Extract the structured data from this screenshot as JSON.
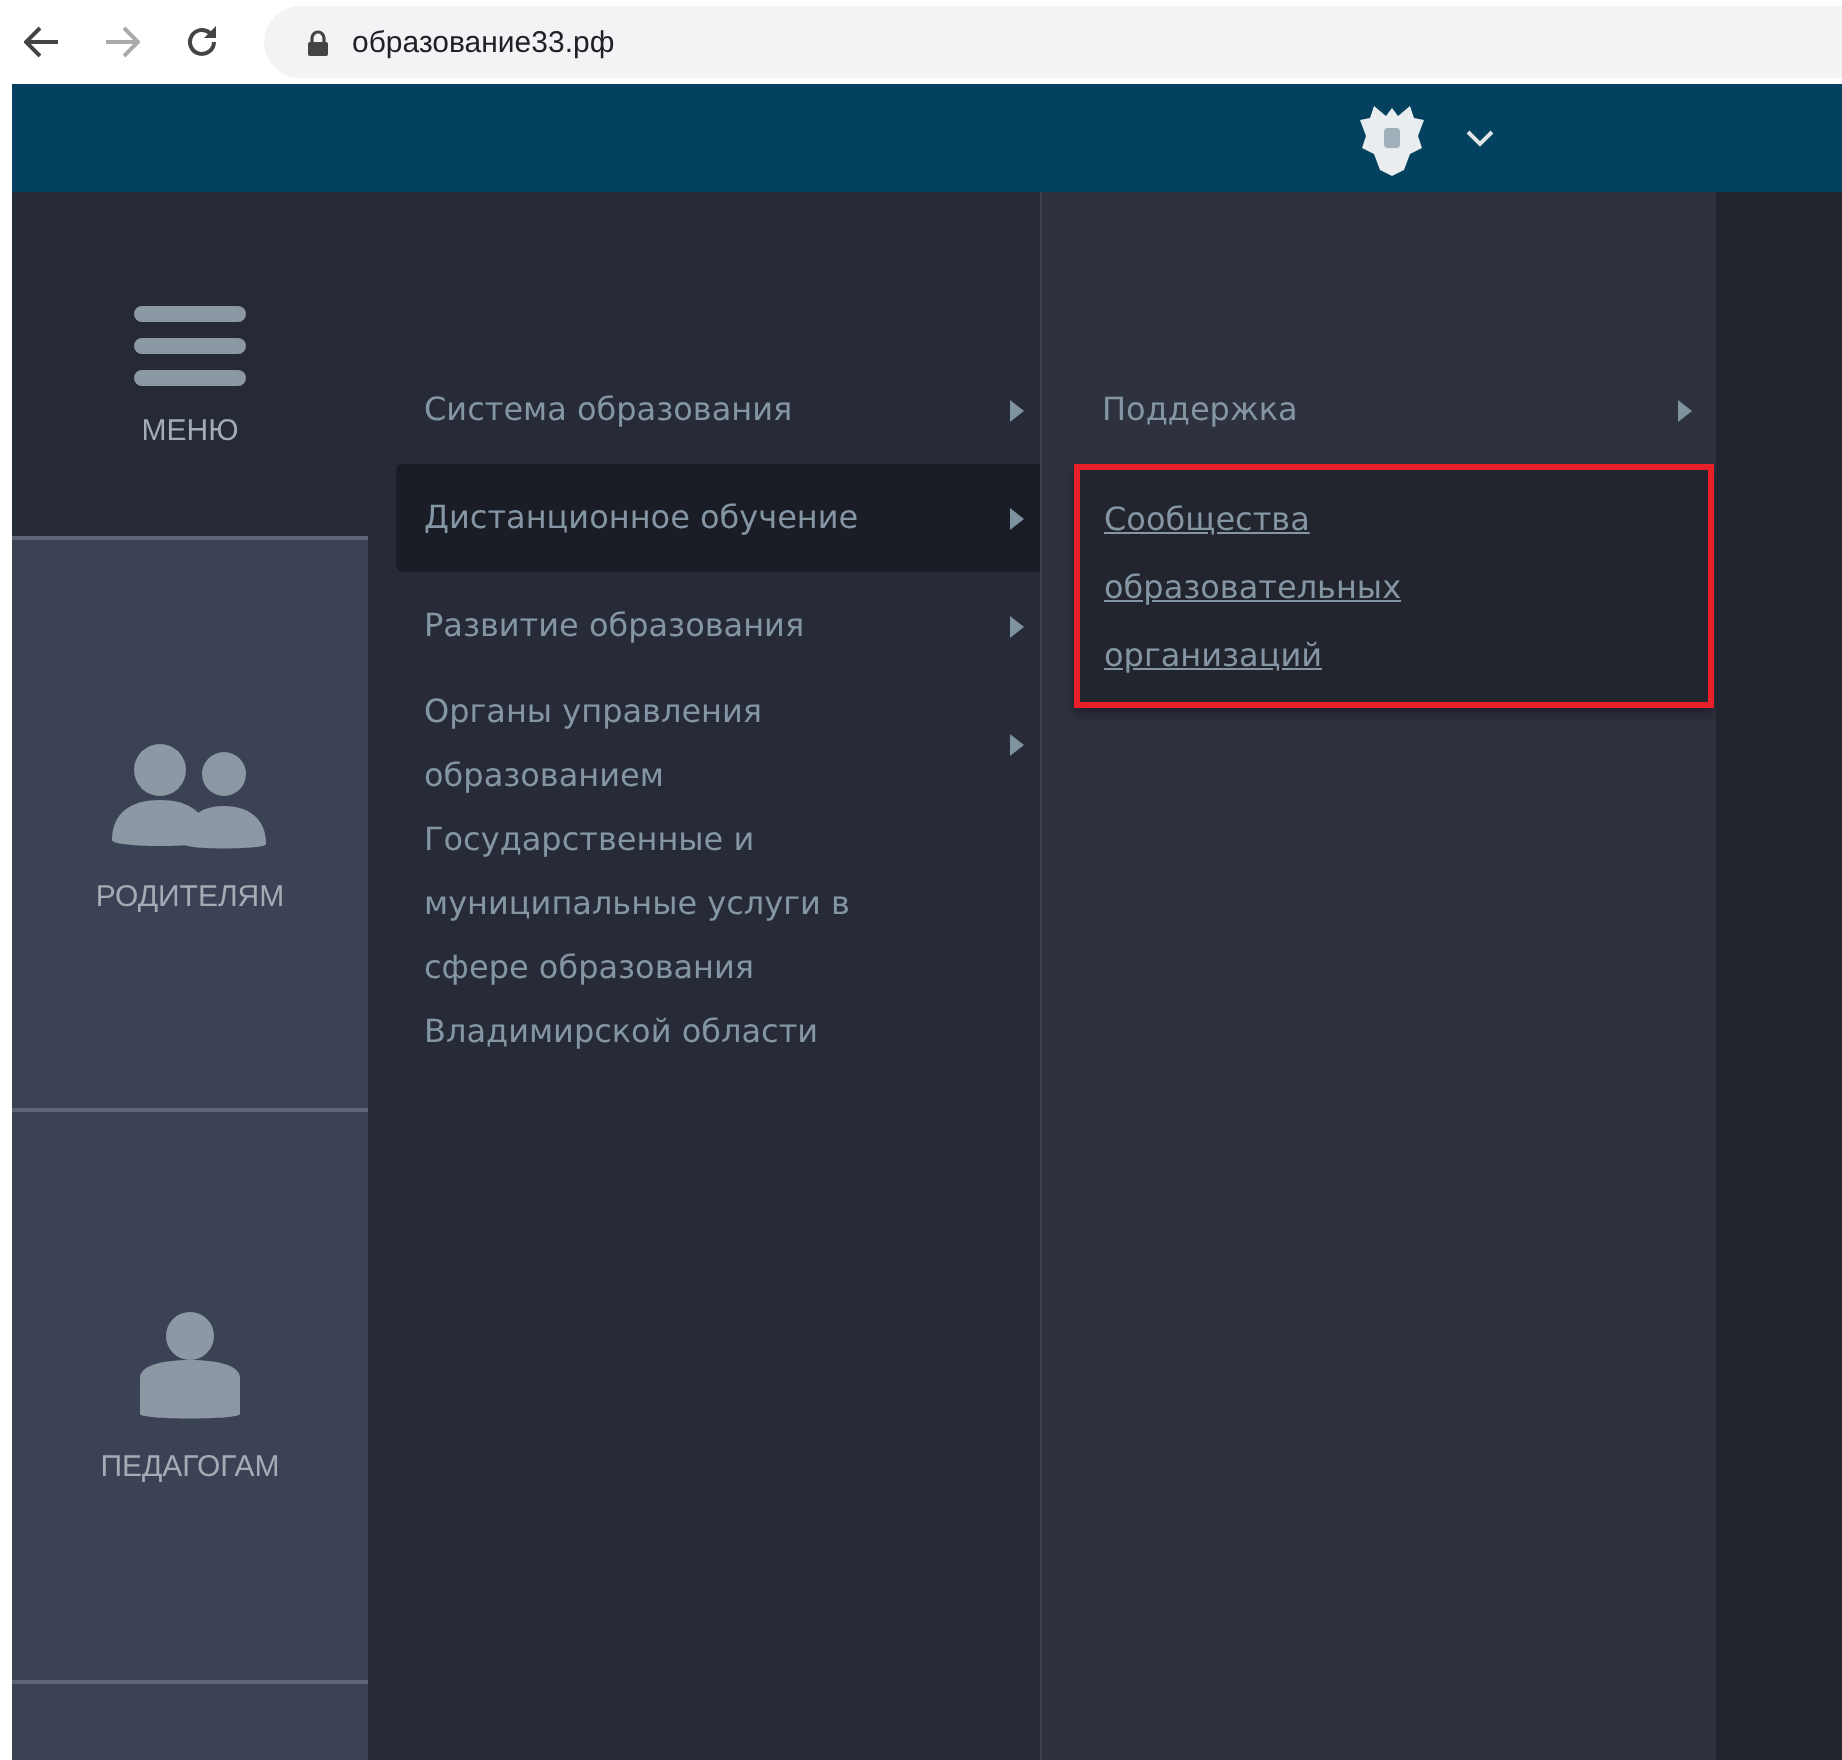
{
  "browser": {
    "url": "образование33.рф"
  },
  "sidebar": {
    "items": [
      {
        "label": "МЕНЮ",
        "kind": "menu",
        "selected": true
      },
      {
        "label": "РОДИТЕЛЯМ",
        "kind": "parents",
        "selected": false
      },
      {
        "label": "ПЕДАГОГАМ",
        "kind": "teacher",
        "selected": false
      },
      {
        "kind": "blank",
        "selected": false
      }
    ]
  },
  "menu": {
    "items": [
      {
        "label": "Система образования",
        "has_submenu": true,
        "selected": false
      },
      {
        "label": "Дистанционное обучение",
        "has_submenu": true,
        "selected": true
      },
      {
        "label": "Развитие образования",
        "has_submenu": true,
        "selected": false
      },
      {
        "label": "Органы управления образованием",
        "has_submenu": true,
        "selected": false
      },
      {
        "label": "Государственные и муниципальные услуги в сфере образования Владимирской области",
        "has_submenu": false,
        "selected": false
      }
    ]
  },
  "submenu": {
    "items": [
      {
        "label": "Поддержка",
        "has_submenu": true,
        "kind": "item"
      },
      {
        "label": "Сообщества образовательных организаций",
        "kind": "link",
        "framed": true
      }
    ]
  }
}
